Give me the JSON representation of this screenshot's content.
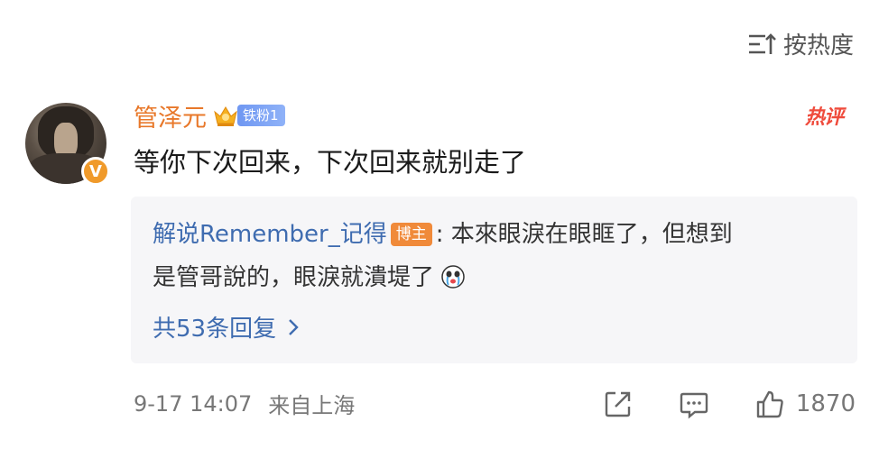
{
  "sort": {
    "label": "按热度",
    "icon": "sort-icon"
  },
  "comment": {
    "author": "管泽元",
    "fan_badge": "铁粉1",
    "hot_tag": "热评",
    "text": "等你下次回来，下次回来就别走了",
    "verified_badge": "V",
    "reply": {
      "author": "解说Remember_记得",
      "author_badge": "博主",
      "separator": ":",
      "text_line1": "本來眼淚在眼眶了，但想到",
      "text_line2": "是管哥說的，眼淚就潰堤了",
      "reply_count": "共53条回复"
    },
    "timestamp": "9-17 14:07",
    "source": "来自上海",
    "likes": "1870"
  },
  "colors": {
    "author": "#e8782a",
    "link": "#3f6cb0",
    "hot": "#ef4b3c",
    "badge_orange": "#f08a3a",
    "fan_badge": "#7ea4f5"
  }
}
